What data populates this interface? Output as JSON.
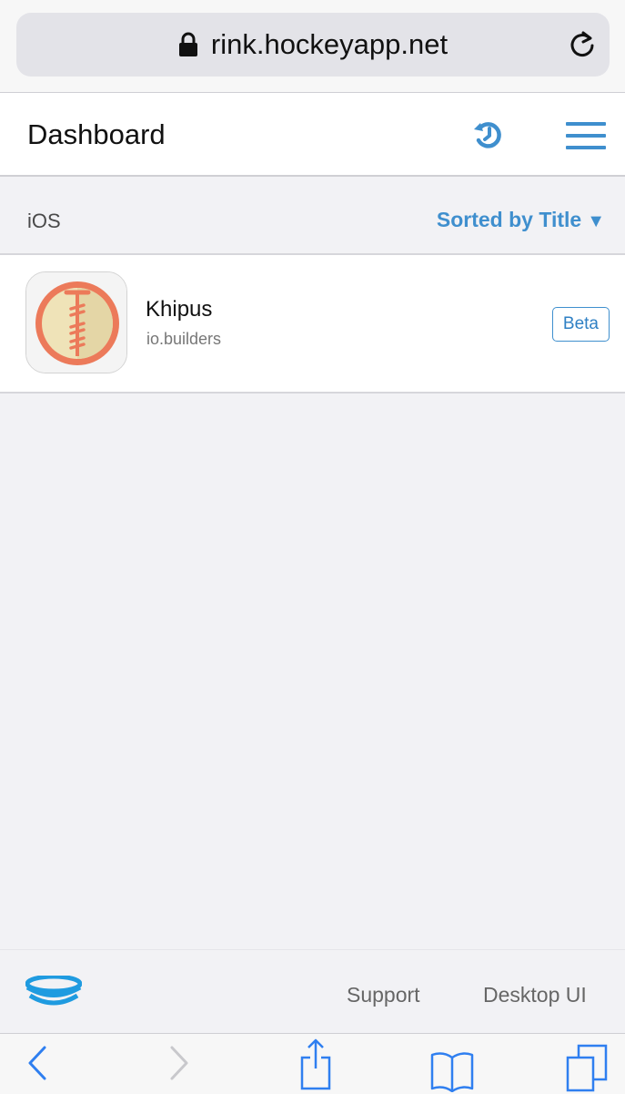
{
  "browser": {
    "url": "rink.hockeyapp.net",
    "icons": {
      "lock": "lock-icon",
      "reload": "reload-icon"
    }
  },
  "header": {
    "title": "Dashboard",
    "icons": {
      "history": "history-icon",
      "menu": "hamburger-menu-icon"
    },
    "accent_color": "#3f8fce"
  },
  "section": {
    "title": "iOS",
    "sort_label": "Sorted by Title",
    "sort_arrow": "▼"
  },
  "apps": [
    {
      "name": "Khipus",
      "bundle_id": "io.builders",
      "badge": "Beta",
      "icon": "khipus-app-icon"
    }
  ],
  "footer": {
    "logo": "hockeyapp-logo-icon",
    "links": [
      "Support",
      "Desktop UI"
    ]
  },
  "toolbar": {
    "icons": [
      "back-icon",
      "forward-icon",
      "share-icon",
      "bookmarks-icon",
      "tabs-icon"
    ],
    "tint_color": "#2f7ff0"
  }
}
